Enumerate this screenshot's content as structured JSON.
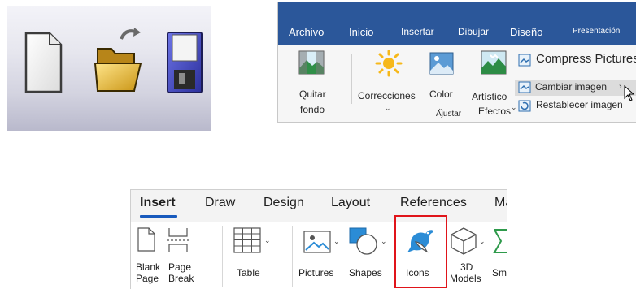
{
  "classic_toolbar": {
    "icons": [
      "new-document-icon",
      "open-folder-icon",
      "save-floppy-icon"
    ]
  },
  "ribbon_es": {
    "tabs": [
      "Archivo",
      "Inicio",
      "Insertar",
      "Dibujar",
      "Diseño",
      "Presentación"
    ],
    "commands": {
      "quitar_fondo_1": "Quitar",
      "quitar_fondo_2": "fondo",
      "correcciones": "Correcciones",
      "color": "Color",
      "artistico_1": "Artístico",
      "artistico_2": "Efectos",
      "compress": "Compress Pictures",
      "cambiar": "Cambiar imagen",
      "restablecer": "Restablecer imagen"
    },
    "group_label": "Ajustar",
    "colors": {
      "tab_bar": "#2b579a",
      "body": "#f6f6f6"
    }
  },
  "ribbon_en": {
    "tabs": [
      "Insert",
      "Draw",
      "Design",
      "Layout",
      "References",
      "Ma"
    ],
    "active_tab": "Insert",
    "commands": {
      "blank_page_1": "Blank",
      "blank_page_2": "Page",
      "page_break_1": "Page",
      "page_break_2": "Break",
      "table": "Table",
      "pictures": "Pictures",
      "shapes": "Shapes",
      "icons": "Icons",
      "models_1": "3D",
      "models_2": "Models",
      "smartart": "Sma"
    },
    "highlighted_command": "Icons",
    "colors": {
      "highlight_box": "#e0141a",
      "active_underline": "#185abd"
    }
  }
}
